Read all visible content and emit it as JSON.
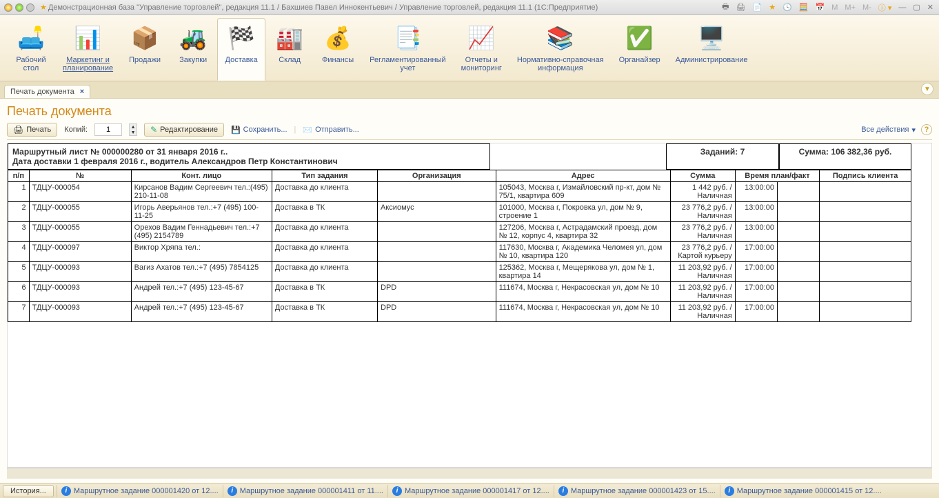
{
  "window": {
    "title": "Демонстрационная база \"Управление торговлей\", редакция 11.1 / Бахшиев Павел Иннокентьевич / Управление торговлей, редакция 11.1  (1С:Предприятие)"
  },
  "sections": [
    {
      "label": "Рабочий\nстол",
      "icon": "🛋️"
    },
    {
      "label": "Маркетинг и\nпланирование",
      "icon": "📊",
      "underline": true
    },
    {
      "label": "Продажи",
      "icon": "📦"
    },
    {
      "label": "Закупки",
      "icon": "🚜"
    },
    {
      "label": "Доставка",
      "icon": "🏁",
      "active": true
    },
    {
      "label": "Склад",
      "icon": "🏭"
    },
    {
      "label": "Финансы",
      "icon": "💰"
    },
    {
      "label": "Регламентированный\nучет",
      "icon": "📑"
    },
    {
      "label": "Отчеты и\nмониторинг",
      "icon": "📈"
    },
    {
      "label": "Нормативно-справочная\nинформация",
      "icon": "📚"
    },
    {
      "label": "Органайзер",
      "icon": "✅"
    },
    {
      "label": "Администрирование",
      "icon": "🖥️"
    }
  ],
  "tab": {
    "label": "Печать документа"
  },
  "page": {
    "title": "Печать документа"
  },
  "cmdbar": {
    "print": "Печать",
    "copies_label": "Копий:",
    "copies_value": "1",
    "edit": "Редактирование",
    "save": "Сохранить...",
    "send": "Отправить...",
    "all_actions": "Все действия"
  },
  "doc": {
    "title_line1": "Маршрутный лист № 000000280 от 31 января 2016 г..",
    "title_line2": "Дата доставки 1 февраля 2016 г., водитель Александров Петр Константинович",
    "tasks_label": "Заданий: 7",
    "sum_label": "Сумма: 106 382,36 руб."
  },
  "columns": {
    "pp": "п/п",
    "no": "№",
    "contact": "Конт. лицо",
    "type": "Тип задания",
    "org": "Организация",
    "addr": "Адрес",
    "sum": "Сумма",
    "time": "Время план/факт",
    "sign": "Подпись клиента"
  },
  "rows": [
    {
      "pp": "1",
      "no": "ТДЦУ-000054",
      "contact": "Кирсанов Вадим Сергеевич тел.:(495) 210-11-08",
      "type": "Доставка до клиента",
      "org": "",
      "addr": "105043, Москва г, Измайловский пр-кт, дом № 75/1, квартира 609",
      "sum": "1 442 руб. /Наличная",
      "time": "13:00:00"
    },
    {
      "pp": "2",
      "no": "ТДЦУ-000055",
      "contact": "Игорь Аверьянов тел.:+7 (495) 100-11-25",
      "type": "Доставка в ТК",
      "org": "Аксиомус",
      "addr": "101000, Москва г, Покровка ул, дом № 9, строение 1",
      "sum": "23 776,2 руб. /Наличная",
      "time": "13:00:00"
    },
    {
      "pp": "3",
      "no": "ТДЦУ-000055",
      "contact": "Орехов Вадим Геннадьевич тел.:+7 (495) 2154789",
      "type": "Доставка до клиента",
      "org": "",
      "addr": "127206, Москва г, Астрадамский проезд, дом № 12, корпус 4, квартира 32",
      "sum": "23 776,2 руб. /Наличная",
      "time": "13:00:00"
    },
    {
      "pp": "4",
      "no": "ТДЦУ-000097",
      "contact": "Виктор Хряпа тел.:",
      "type": "Доставка до клиента",
      "org": "",
      "addr": "117630, Москва г, Академика Челомея ул, дом № 10, квартира 120",
      "sum": "23 776,2 руб. /Картой курьеру",
      "time": "17:00:00"
    },
    {
      "pp": "5",
      "no": "ТДЦУ-000093",
      "contact": "Вагиз Ахатов тел.:+7 (495) 7854125",
      "type": "Доставка до клиента",
      "org": "",
      "addr": "125362, Москва г, Мещерякова ул, дом № 1, квартира 14",
      "sum": "11 203,92 руб. /Наличная",
      "time": "17:00:00"
    },
    {
      "pp": "6",
      "no": "ТДЦУ-000093",
      "contact": "Андрей тел.:+7 (495) 123-45-67",
      "type": "Доставка в ТК",
      "org": "DPD",
      "addr": "111674, Москва г, Некрасовская ул, дом № 10",
      "sum": "11 203,92 руб. /Наличная",
      "time": "17:00:00"
    },
    {
      "pp": "7",
      "no": "ТДЦУ-000093",
      "contact": "Андрей тел.:+7 (495) 123-45-67",
      "type": "Доставка в ТК",
      "org": "DPD",
      "addr": "111674, Москва г, Некрасовская ул, дом № 10",
      "sum": "11 203,92 руб. /Наличная",
      "time": "17:00:00"
    }
  ],
  "statusbar": {
    "history": "История...",
    "items": [
      "Маршрутное задание 000001420 от 12....",
      "Маршрутное задание 000001411 от 11....",
      "Маршрутное задание 000001417 от 12....",
      "Маршрутное задание 000001423 от 15....",
      "Маршрутное задание 000001415 от 12...."
    ]
  }
}
